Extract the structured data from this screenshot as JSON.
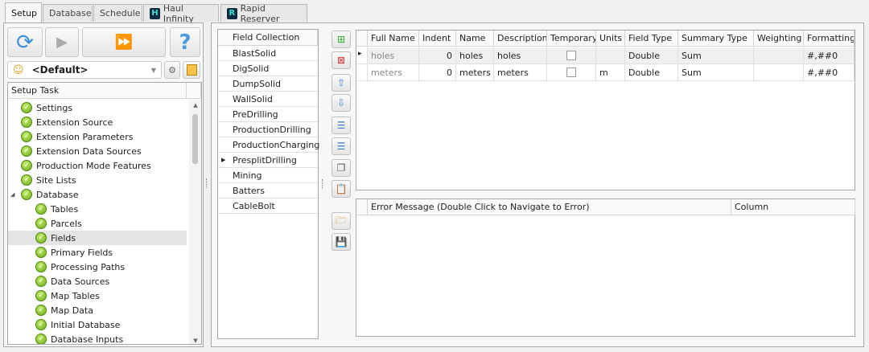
{
  "tabs": [
    {
      "label": "Setup"
    },
    {
      "label": "Database"
    },
    {
      "label": "Schedule"
    },
    {
      "label": "Haul Infinity",
      "icon": "H"
    },
    {
      "label": "Rapid Reserver",
      "icon": "R"
    }
  ],
  "left": {
    "profile": "<Default>",
    "tree_header": "Setup Task",
    "tree": [
      {
        "label": "Settings",
        "level": 0
      },
      {
        "label": "Extension Source",
        "level": 0
      },
      {
        "label": "Extension Parameters",
        "level": 0
      },
      {
        "label": "Extension Data Sources",
        "level": 0
      },
      {
        "label": "Production Mode Features",
        "level": 0
      },
      {
        "label": "Site Lists",
        "level": 0
      },
      {
        "label": "Database",
        "level": 0,
        "expanded": true
      },
      {
        "label": "Tables",
        "level": 1
      },
      {
        "label": "Parcels",
        "level": 1
      },
      {
        "label": "Fields",
        "level": 1,
        "selected": true
      },
      {
        "label": "Primary Fields",
        "level": 1
      },
      {
        "label": "Processing Paths",
        "level": 1
      },
      {
        "label": "Data Sources",
        "level": 1
      },
      {
        "label": "Map Tables",
        "level": 1
      },
      {
        "label": "Map Data",
        "level": 1
      },
      {
        "label": "Initial Database",
        "level": 1
      },
      {
        "label": "Database Inputs",
        "level": 1
      }
    ]
  },
  "field_collection": {
    "header": "Field Collection",
    "items": [
      "BlastSolid",
      "DigSolid",
      "DumpSolid",
      "WallSolid",
      "PreDrilling",
      "ProductionDrilling",
      "ProductionCharging",
      "PresplitDrilling",
      "Mining",
      "Batters",
      "CableBolt"
    ],
    "current": "PresplitDrilling"
  },
  "fields_grid": {
    "columns": [
      "Full Name",
      "Indent",
      "Name",
      "Description",
      "Temporary",
      "Units",
      "Field Type",
      "Summary Type",
      "Weighting",
      "Formatting"
    ],
    "rows": [
      [
        "holes",
        "0",
        "holes",
        "holes",
        false,
        "",
        "Double",
        "Sum",
        "",
        "#,##0"
      ],
      [
        "meters",
        "0",
        "meters",
        "meters",
        false,
        "m",
        "Double",
        "Sum",
        "",
        "#,##0"
      ]
    ]
  },
  "error_grid": {
    "columns": [
      "Error Message (Double Click to Navigate to Error)",
      "Column"
    ]
  }
}
